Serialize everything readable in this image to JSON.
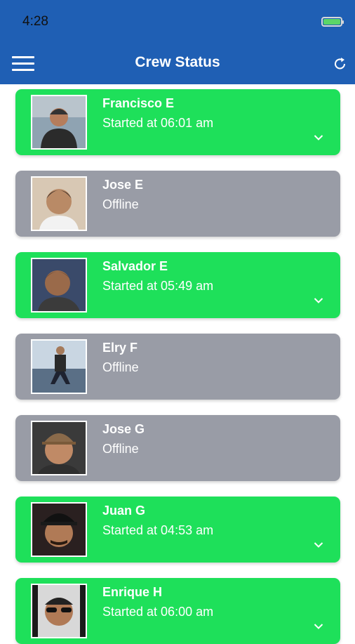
{
  "status_bar": {
    "time": "4:28"
  },
  "header": {
    "title": "Crew Status"
  },
  "crew": [
    {
      "name": "Francisco E",
      "status": "Started at 06:01 am",
      "state": "active"
    },
    {
      "name": "Jose E",
      "status": "Offline",
      "state": "offline"
    },
    {
      "name": "Salvador E",
      "status": "Started at 05:49 am",
      "state": "active"
    },
    {
      "name": "Elry F",
      "status": "Offline",
      "state": "offline"
    },
    {
      "name": "Jose G",
      "status": "Offline",
      "state": "offline"
    },
    {
      "name": "Juan G",
      "status": "Started at 04:53 am",
      "state": "active"
    },
    {
      "name": "Enrique H",
      "status": "Started at 06:00 am",
      "state": "active"
    }
  ],
  "colors": {
    "active": "#1ee05a",
    "offline": "#999ca6",
    "header": "#1f5fb4"
  },
  "icons": {
    "menu": "hamburger-menu-icon",
    "refresh": "refresh-icon",
    "expand": "chevron-down-icon"
  }
}
